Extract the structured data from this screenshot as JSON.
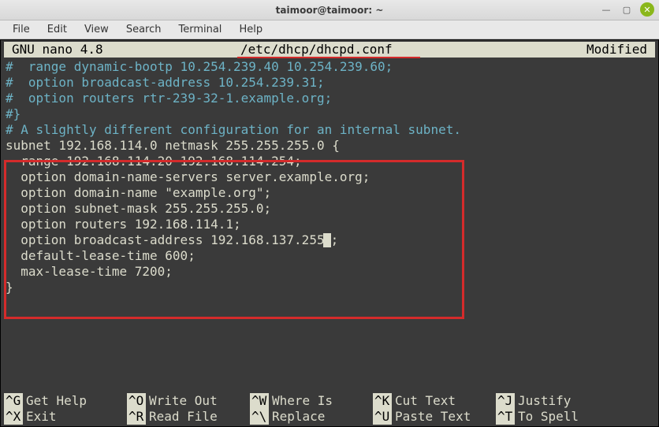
{
  "window": {
    "title": "taimoor@taimoor: ~"
  },
  "menu": {
    "file": "File",
    "edit": "Edit",
    "view": "View",
    "search": "Search",
    "terminal": "Terminal",
    "help": "Help"
  },
  "nano": {
    "app": "  GNU nano 4.8",
    "filepath": "/etc/dhcp/dhcpd.conf",
    "status": "Modified"
  },
  "file_lines": {
    "l1": "#  range dynamic-bootp 10.254.239.40 10.254.239.60;",
    "l2": "#  option broadcast-address 10.254.239.31;",
    "l3": "#  option routers rtr-239-32-1.example.org;",
    "l4": "#}",
    "l5": "",
    "l6": "# A slightly different configuration for an internal subnet.",
    "l7": "subnet 192.168.114.0 netmask 255.255.255.0 {",
    "l8": "  range 192.168.114.20 192.168.114.254;",
    "l9": "  option domain-name-servers server.example.org;",
    "l10": "  option domain-name \"example.org\";",
    "l11": "  option subnet-mask 255.255.255.0;",
    "l12": "  option routers 192.168.114.1;",
    "l13_a": "  option broadcast-address 192.168.137.255",
    "l13_b": ";",
    "l14": "  default-lease-time 600;",
    "l15": "  max-lease-time 7200;",
    "l16": "}"
  },
  "shortcuts": {
    "r1": {
      "k1": "^G",
      "l1": "Get Help",
      "k2": "^O",
      "l2": "Write Out",
      "k3": "^W",
      "l3": "Where Is",
      "k4": "^K",
      "l4": "Cut Text",
      "k5": "^J",
      "l5": "Justify"
    },
    "r2": {
      "k1": "^X",
      "l1": "Exit",
      "k2": "^R",
      "l2": "Read File",
      "k3": "^\\",
      "l3": "Replace",
      "k4": "^U",
      "l4": "Paste Text",
      "k5": "^T",
      "l5": "To Spell"
    }
  }
}
